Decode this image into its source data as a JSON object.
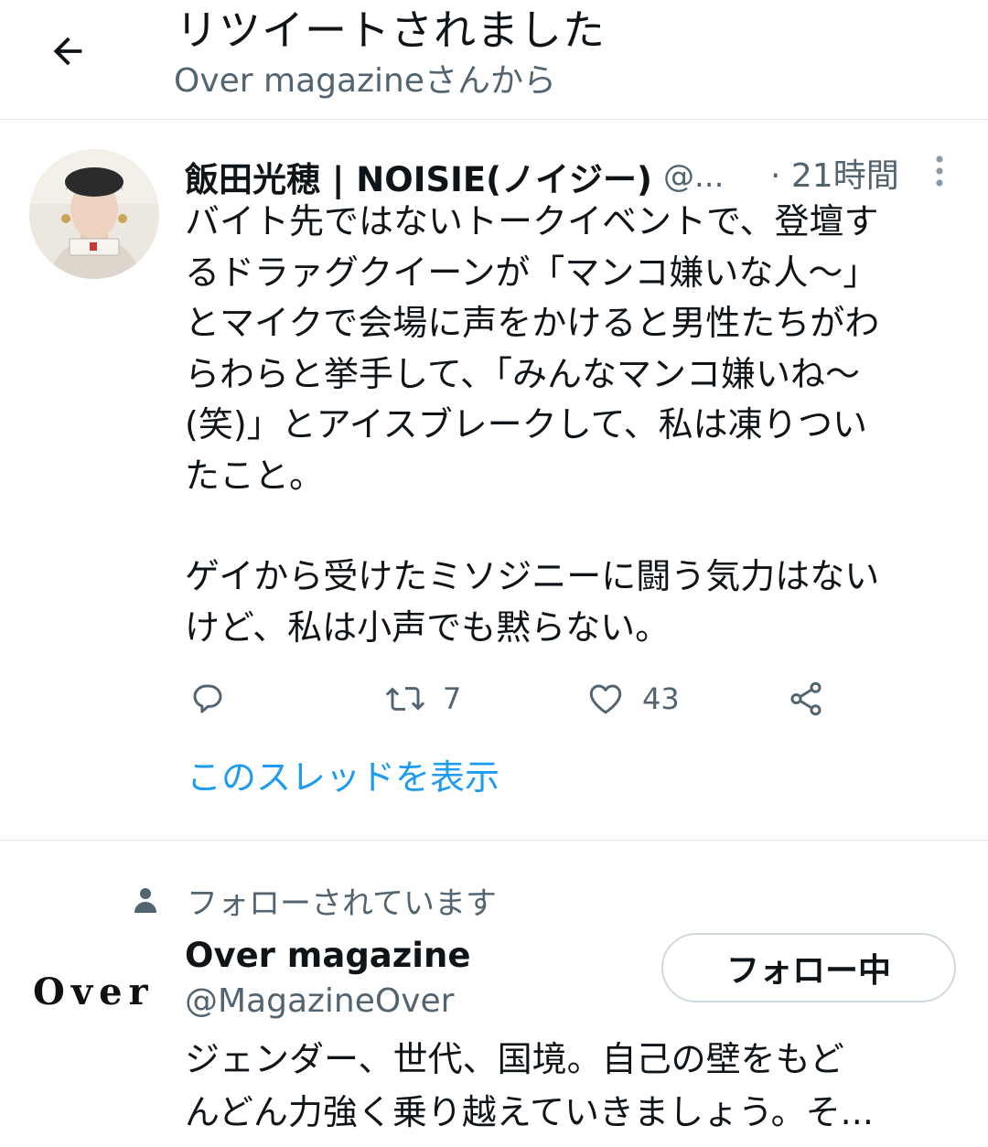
{
  "header": {
    "title": "リツイートされました",
    "subtitle": "Over magazineさんから"
  },
  "tweet": {
    "author_name": "飯田光穂 | NOISIE(ノイジー)",
    "author_handle": "@...",
    "time": "· 21時間",
    "body_lines": [
      "バイト先ではないトークイベントで、登壇す",
      "るドラァグクイーンが「マンコ嫌いな人〜」",
      "とマイクで会場に声をかけると男性たちがわ",
      "らわらと挙手して、「みんなマンコ嫌いね〜",
      "(笑)」とアイスブレークして、私は凍りつい",
      "たこと。",
      "",
      "ゲイから受けたミソジニーに闘う気力はない",
      "けど、私は小声でも黙らない。"
    ],
    "retweet_count": "7",
    "like_count": "43",
    "thread_link": "このスレッドを表示"
  },
  "follow_card": {
    "followed_label": "フォローされています",
    "logo_text": "Over",
    "name": "Over magazine",
    "handle": "@MagazineOver",
    "follow_button": "フォロー中",
    "bio_lines": [
      "ジェンダー、世代、国境。自己の壁をもど",
      "んどん力強く乗り越えていきましょう。そ..."
    ]
  },
  "colors": {
    "primary_text": "#0f1419",
    "secondary_text": "#536471",
    "link": "#1d9bf0",
    "divider": "#e1e6ea"
  }
}
